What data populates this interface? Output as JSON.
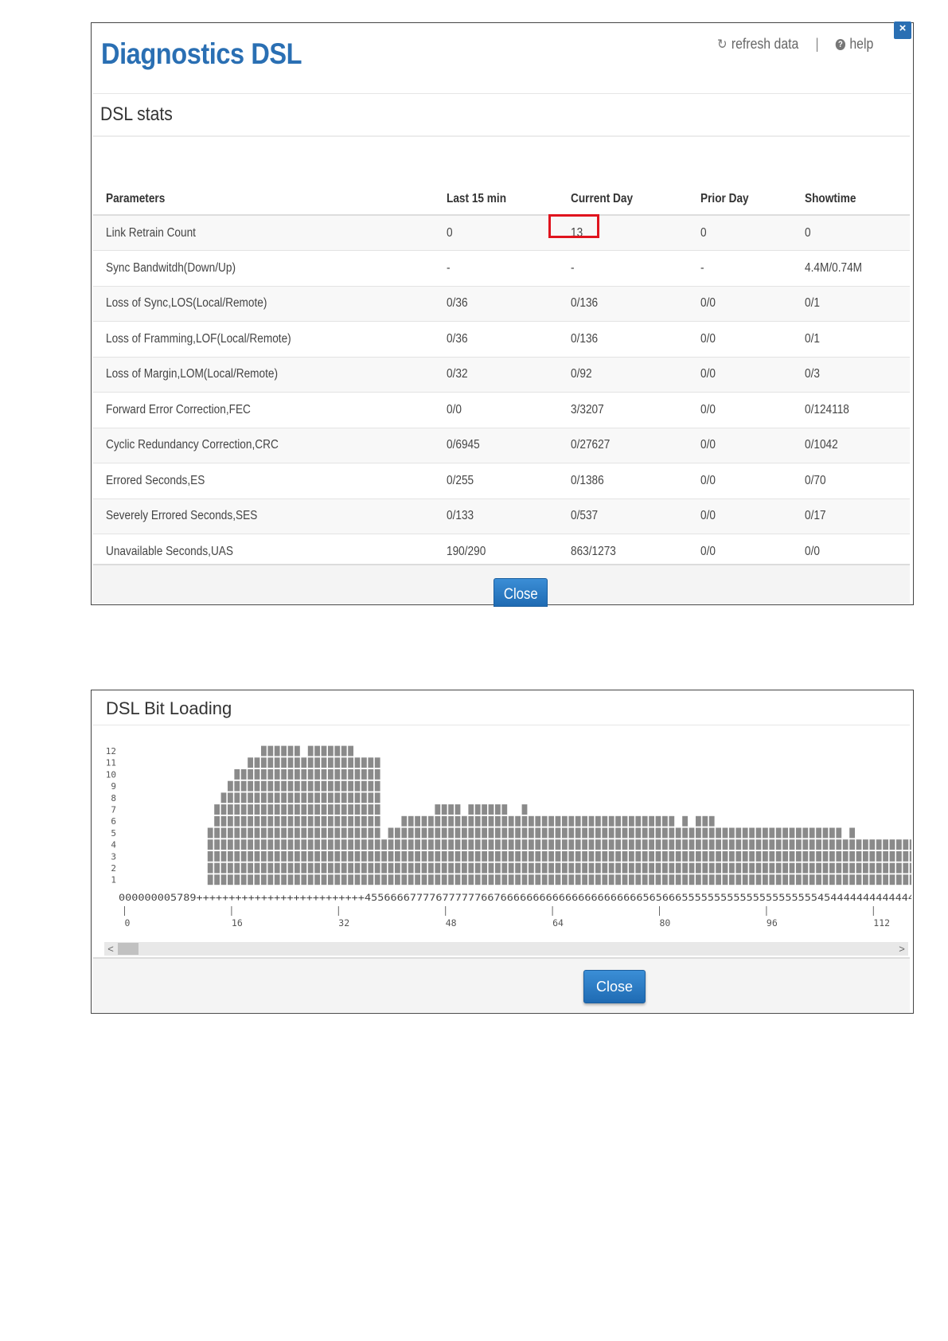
{
  "stats_dialog": {
    "title": "Diagnostics DSL",
    "refresh_label": "refresh data",
    "separator": "|",
    "help_label": "help",
    "close_x": "×",
    "section_title": "DSL stats",
    "columns": [
      "Parameters",
      "Last 15 min",
      "Current Day",
      "Prior Day",
      "Showtime"
    ],
    "rows": [
      {
        "param": "Link Retrain Count",
        "last15": "0",
        "current": "13",
        "prior": "0",
        "showtime": "0"
      },
      {
        "param": "Sync Bandwitdh(Down/Up)",
        "last15": "-",
        "current": "-",
        "prior": "-",
        "showtime": "4.4M/0.74M"
      },
      {
        "param": "Loss of Sync,LOS(Local/Remote)",
        "last15": "0/36",
        "current": "0/136",
        "prior": "0/0",
        "showtime": "0/1"
      },
      {
        "param": "Loss of Framming,LOF(Local/Remote)",
        "last15": "0/36",
        "current": "0/136",
        "prior": "0/0",
        "showtime": "0/1"
      },
      {
        "param": "Loss of Margin,LOM(Local/Remote)",
        "last15": "0/32",
        "current": "0/92",
        "prior": "0/0",
        "showtime": "0/3"
      },
      {
        "param": "Forward Error Correction,FEC",
        "last15": "0/0",
        "current": "3/3207",
        "prior": "0/0",
        "showtime": "0/124118"
      },
      {
        "param": "Cyclic Redundancy Correction,CRC",
        "last15": "0/6945",
        "current": "0/27627",
        "prior": "0/0",
        "showtime": "0/1042"
      },
      {
        "param": "Errored Seconds,ES",
        "last15": "0/255",
        "current": "0/1386",
        "prior": "0/0",
        "showtime": "0/70"
      },
      {
        "param": "Severely Errored Seconds,SES",
        "last15": "0/133",
        "current": "0/537",
        "prior": "0/0",
        "showtime": "0/17"
      },
      {
        "param": "Unavailable Seconds,UAS",
        "last15": "190/290",
        "current": "863/1273",
        "prior": "0/0",
        "showtime": "0/0"
      }
    ],
    "highlight_color": "#e0141e",
    "close_label": "Close"
  },
  "bitload_dialog": {
    "title": "DSL Bit Loading",
    "digit_row": "000000005789++++++++++++++++++++++++++4556666777767777776676666666666666666666666565666555555555555555555555454444444444444",
    "x_tick_labels": [
      "0",
      "16",
      "32",
      "48",
      "64",
      "80",
      "96",
      "112"
    ],
    "close_label": "Close",
    "scroll_left": "<",
    "scroll_right": ">",
    "chart_data": {
      "type": "bar",
      "title": "DSL Bit Loading",
      "xlabel": "",
      "ylabel": "",
      "y_ticks": [
        1,
        2,
        3,
        4,
        5,
        6,
        7,
        8,
        9,
        10,
        11,
        12
      ],
      "ylim": [
        0,
        12
      ],
      "x_ticks": [
        0,
        16,
        32,
        48,
        64,
        80,
        96,
        112
      ],
      "xlim": [
        0,
        114
      ],
      "bar_color": "#8a8a8a",
      "values": [
        0,
        0,
        0,
        0,
        0,
        0,
        0,
        5,
        7,
        8,
        9,
        10,
        10,
        11,
        11,
        12,
        12,
        12,
        12,
        12,
        12,
        11,
        12,
        12,
        12,
        12,
        12,
        12,
        12,
        11,
        11,
        11,
        11,
        4,
        5,
        5,
        6,
        6,
        6,
        6,
        6,
        7,
        7,
        7,
        7,
        6,
        7,
        7,
        7,
        7,
        7,
        7,
        6,
        6,
        7,
        6,
        6,
        6,
        6,
        6,
        6,
        6,
        6,
        6,
        6,
        6,
        6,
        6,
        6,
        6,
        6,
        6,
        6,
        6,
        6,
        6,
        6,
        5,
        6,
        5,
        6,
        6,
        6,
        5,
        5,
        5,
        5,
        5,
        5,
        5,
        5,
        5,
        5,
        5,
        5,
        5,
        5,
        5,
        5,
        5,
        5,
        5,
        4,
        5,
        4,
        4,
        4,
        4,
        4,
        4,
        4,
        4,
        4,
        4,
        4
      ]
    }
  }
}
